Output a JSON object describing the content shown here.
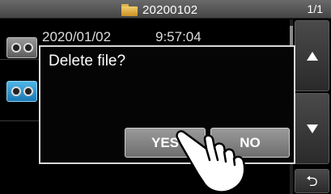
{
  "header": {
    "folder_name": "20200102",
    "page_indicator": "1/1"
  },
  "file_list": {
    "first_row": {
      "date": "2020/01/02",
      "time": "9:57:04"
    }
  },
  "dialog": {
    "message": "Delete file?",
    "yes_label": "YES",
    "no_label": "NO"
  },
  "side_buttons": {
    "up_icon": "triangle-up-icon",
    "down_icon": "triangle-down-icon",
    "back_icon": "return-arrow-icon",
    "back_glyph": "⮌"
  },
  "colors": {
    "selection_accent": "#1e8fd0",
    "folder": "#e0b24a"
  }
}
